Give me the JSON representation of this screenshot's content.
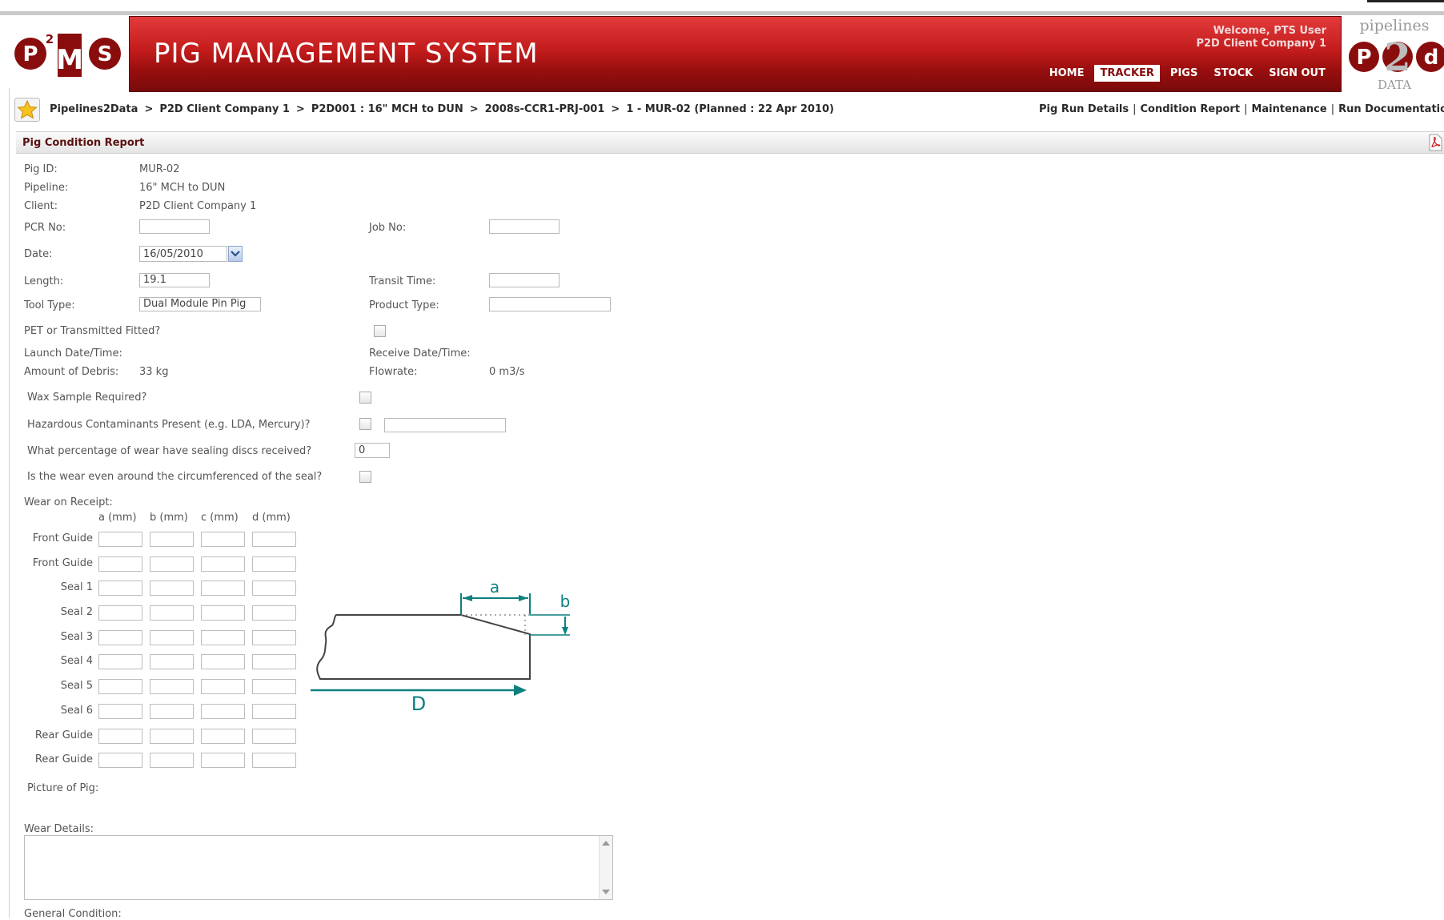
{
  "header": {
    "logo_letters": [
      "P",
      "2",
      "M",
      "S"
    ],
    "title": "PIG MANAGEMENT SYSTEM",
    "welcome_line1": "Welcome, PTS User",
    "welcome_line2": "P2D Client Company 1",
    "nav": [
      {
        "label": "HOME",
        "active": false
      },
      {
        "label": "TRACKER",
        "active": true
      },
      {
        "label": "PIGS",
        "active": false
      },
      {
        "label": "STOCK",
        "active": false
      },
      {
        "label": "SIGN OUT",
        "active": false
      }
    ],
    "p2d_logo": {
      "top": "pipelines",
      "mid_p": "P",
      "mid_2": "2",
      "mid_d": "d",
      "bottom": "DATA"
    }
  },
  "breadcrumb": [
    "Pipelines2Data",
    "P2D Client Company 1",
    "P2D001 : 16\" MCH to DUN",
    "2008s-CCR1-PRJ-001",
    "1 - MUR-02 (Planned : 22 Apr 2010)"
  ],
  "breadcrumb_sep": ">",
  "top_links": [
    "Pig Run Details",
    "Condition Report",
    "Maintenance",
    "Run Documentation"
  ],
  "top_links_sep": "|",
  "report": {
    "title": "Pig Condition Report",
    "pig_id_label": "Pig ID:",
    "pig_id": "MUR-02",
    "pipeline_label": "Pipeline:",
    "pipeline": "16\" MCH to DUN",
    "client_label": "Client:",
    "client": "P2D Client Company 1",
    "pcr_label": "PCR No:",
    "pcr_value": "",
    "job_label": "Job No:",
    "job_value": "",
    "date_label": "Date:",
    "date_value": "16/05/2010",
    "length_label": "Length:",
    "length_value": "19.1",
    "transit_label": "Transit Time:",
    "transit_value": "",
    "tool_label": "Tool Type:",
    "tool_value": "Dual Module Pin Pig",
    "product_label": "Product Type:",
    "product_value": "",
    "pet_label": "PET or Transmitted Fitted?",
    "launch_label": "Launch Date/Time:",
    "receive_label": "Receive Date/Time:",
    "debris_label": "Amount of Debris:",
    "debris_value": "33 kg",
    "flow_label": "Flowrate:",
    "flow_value": "0 m3/s",
    "wax_label": "Wax Sample Required?",
    "hazard_label": "Hazardous Contaminants Present (e.g. LDA, Mercury)?",
    "hazard_value": "",
    "wear_pct_label": "What percentage of wear have sealing discs received?",
    "wear_pct_value": "0",
    "wear_even_label": "Is the wear even around the circumferenced of the seal?",
    "wear_receipt_label": "Wear on Receipt:",
    "columns": [
      "a (mm)",
      "b (mm)",
      "c (mm)",
      "d (mm)"
    ],
    "rows": [
      "Front Guide",
      "Front Guide",
      "Seal 1",
      "Seal 2",
      "Seal 3",
      "Seal 4",
      "Seal 5",
      "Seal 6",
      "Rear Guide",
      "Rear Guide"
    ],
    "diagram": {
      "a": "a",
      "b": "b",
      "d": "D"
    },
    "picture_label": "Picture of Pig:",
    "wear_details_label": "Wear Details:",
    "general_label": "General Condition:"
  }
}
